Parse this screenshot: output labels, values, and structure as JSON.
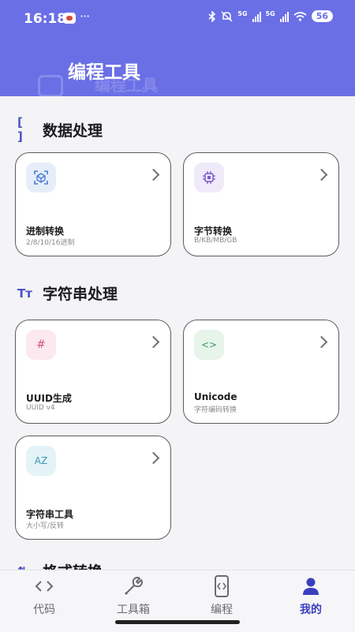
{
  "status_bar": {
    "time": "16:18",
    "more": "···",
    "network_a": "5G",
    "network_b": "5G",
    "battery": "56"
  },
  "header": {
    "title": "编程工具",
    "ghost_title": "编程工具"
  },
  "sections": [
    {
      "title": "数据处理",
      "icon": "brackets-icon",
      "icon_text": "[ ]"
    },
    {
      "title": "字符串处理",
      "icon": "text-size-icon",
      "icon_text": "Tт"
    },
    {
      "title": "格式转换",
      "icon": "format-icon"
    }
  ],
  "cards": [
    {
      "name": "进制转换",
      "desc": "2/8/10/16进制",
      "icon": "cube-scan-icon",
      "icon_bg": "#e6eef9",
      "icon_color": "#4a7bd3"
    },
    {
      "name": "字节转换",
      "desc": "B/KB/MB/GB",
      "icon": "chip-icon",
      "icon_bg": "#efeafa",
      "icon_color": "#7a55c9"
    },
    {
      "name": "UUID生成",
      "desc": "UUID v4",
      "icon": "hash-icon",
      "icon_text": "#",
      "icon_bg": "#fbe9ef",
      "icon_color": "#d6587d"
    },
    {
      "name": "Unicode",
      "desc": "字符编码转换",
      "icon": "code-icon",
      "icon_text": "<>",
      "icon_bg": "#e6f4ea",
      "icon_color": "#3f9a5c"
    },
    {
      "name": "字符串工具",
      "desc": "大小写/反转",
      "icon": "az-sort-icon",
      "icon_text": "AZ",
      "icon_bg": "#e3f3f8",
      "icon_color": "#3a9ab7"
    }
  ],
  "nav": [
    {
      "label": "代码",
      "icon": "code-brackets-icon"
    },
    {
      "label": "工具箱",
      "icon": "wrench-icon"
    },
    {
      "label": "编程",
      "icon": "device-code-icon"
    },
    {
      "label": "我的",
      "icon": "person-icon",
      "active": true
    }
  ],
  "colors": {
    "header": "#6a6fe6",
    "accent": "#3a3fbf"
  }
}
